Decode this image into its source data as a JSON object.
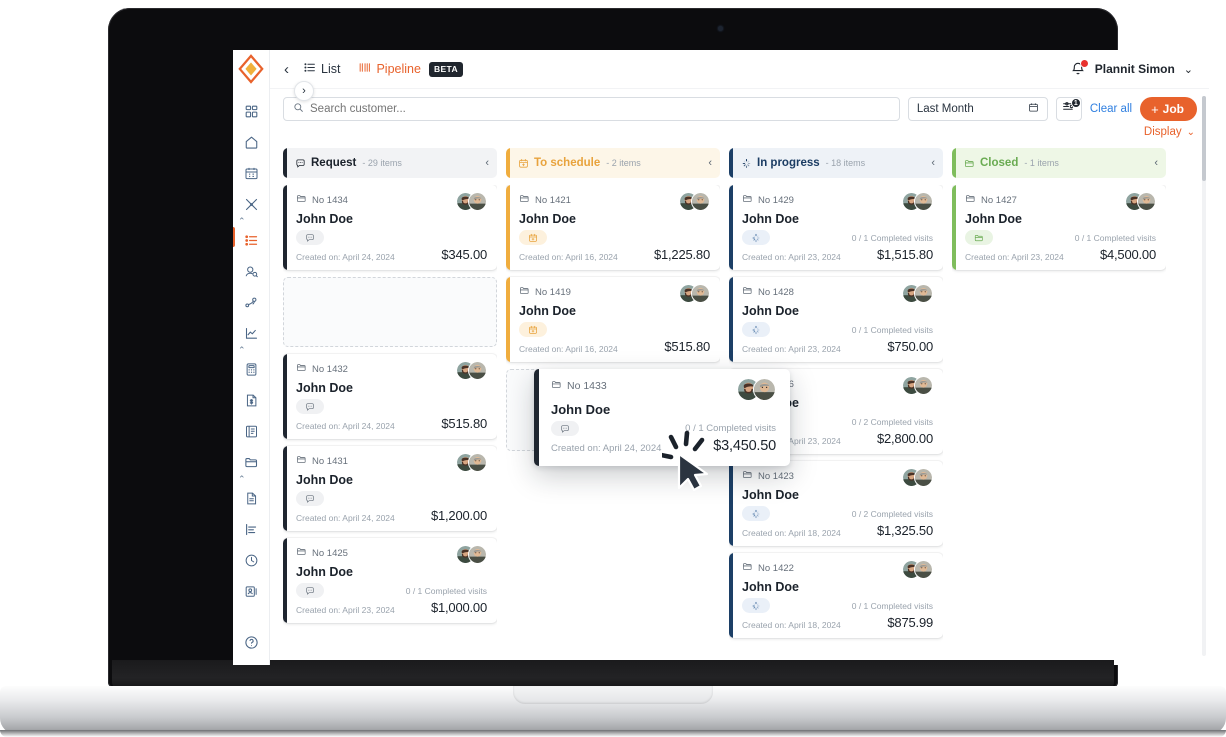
{
  "app": {
    "brand_accent": "#e8622c",
    "nav": {
      "back_icon": "chevron-left-icon",
      "tabs": [
        {
          "label": "List",
          "icon": "list-icon",
          "active": false
        },
        {
          "label": "Pipeline",
          "icon": "pipeline-icon",
          "active": true
        }
      ],
      "beta_badge": "BETA",
      "user_name": "Plannit Simon",
      "bell_icon": "notification-bell-icon",
      "user_caret_icon": "chevron-down-icon"
    },
    "sidebar": {
      "expand_icon": "chevron-right-icon",
      "items": [
        {
          "name": "dashboard",
          "icon": "grid-icon"
        },
        {
          "name": "home",
          "icon": "home-icon"
        },
        {
          "name": "calendar",
          "icon": "calendar-icon"
        },
        {
          "name": "tools",
          "icon": "tools-icon",
          "has_chevron": true
        },
        {
          "name": "jobs",
          "icon": "list-lines-icon",
          "active": true
        },
        {
          "name": "customers",
          "icon": "people-search-icon"
        },
        {
          "name": "routes",
          "icon": "route-pin-icon"
        },
        {
          "name": "reports",
          "icon": "chart-line-icon",
          "has_chevron": true
        },
        {
          "name": "accounting",
          "icon": "calculator-icon"
        },
        {
          "name": "invoices",
          "icon": "invoice-dollar-icon"
        },
        {
          "name": "books",
          "icon": "book-icon"
        },
        {
          "name": "files",
          "icon": "folder-icon",
          "has_chevron": true
        },
        {
          "name": "documents",
          "icon": "document-icon"
        },
        {
          "name": "activity",
          "icon": "bars-left-icon"
        },
        {
          "name": "timesheet",
          "icon": "clock-icon"
        },
        {
          "name": "contacts",
          "icon": "contact-card-icon"
        }
      ],
      "help": {
        "name": "help",
        "icon": "question-circle-icon"
      }
    },
    "filters": {
      "search_placeholder": "Search customer...",
      "search_value": "",
      "search_icon": "search-icon",
      "date_range": "Last Month",
      "date_icon": "calendar-icon",
      "filter_icon": "sliders-icon",
      "filter_badge": "1",
      "clear_all": "Clear all",
      "add_job": "Job",
      "add_job_plus": "+",
      "display": "Display",
      "display_caret_icon": "chevron-down-icon"
    }
  },
  "board": {
    "columns": [
      {
        "id": "request",
        "title": "Request",
        "count": "- 29 items",
        "icon": "chat-bubble-icon",
        "bar_color": "#1f2630",
        "head_bg": "#f2f3f5",
        "title_color": "#1b222b",
        "pill_class": "",
        "collapse_icon": "chevron-left-icon",
        "cards": [
          {
            "no": "No 1434",
            "name": "John Doe",
            "visits": "",
            "created": "Created on: April 24, 2024",
            "amount": "$345.00",
            "pill_icon": "chat-bubble-icon"
          },
          {
            "ghost": true,
            "height": 70
          },
          {
            "no": "No 1432",
            "name": "John Doe",
            "visits": "",
            "created": "Created on: April 24, 2024",
            "amount": "$515.80",
            "pill_icon": "chat-bubble-icon"
          },
          {
            "no": "No 1431",
            "name": "John Doe",
            "visits": "",
            "created": "Created on: April 24, 2024",
            "amount": "$1,200.00",
            "pill_icon": "chat-bubble-icon"
          },
          {
            "no": "No 1425",
            "name": "John Doe",
            "visits": "0 / 1 Completed visits",
            "created": "Created on: April 23, 2024",
            "amount": "$1,000.00",
            "pill_icon": "chat-bubble-icon"
          }
        ]
      },
      {
        "id": "to-schedule",
        "title": "To schedule",
        "count": "- 2 items",
        "icon": "calendar-plus-icon",
        "bar_color": "#f0ad3e",
        "head_bg": "#fdf6e8",
        "title_color": "#e8a33d",
        "pill_class": "amber",
        "collapse_icon": "chevron-left-icon",
        "cards": [
          {
            "no": "No 1421",
            "name": "John Doe",
            "visits": "",
            "created": "Created on: April 16, 2024",
            "amount": "$1,225.80",
            "pill_icon": "calendar-plus-icon"
          },
          {
            "no": "No 1419",
            "name": "John Doe",
            "visits": "",
            "created": "Created on: April 16, 2024",
            "amount": "$515.80",
            "pill_icon": "calendar-plus-icon"
          },
          {
            "ghost": true,
            "height": 82
          }
        ]
      },
      {
        "id": "in-progress",
        "title": "In progress",
        "count": "- 18 items",
        "icon": "spinner-icon",
        "bar_color": "#1c3f66",
        "head_bg": "#eef2f7",
        "title_color": "#1b3c63",
        "pill_class": "blue",
        "collapse_icon": "chevron-left-icon",
        "cards": [
          {
            "no": "No 1429",
            "name": "John Doe",
            "visits": "0 / 1 Completed visits",
            "created": "Created on: April 23, 2024",
            "amount": "$1,515.80",
            "pill_icon": "spinner-icon"
          },
          {
            "no": "No 1428",
            "name": "John Doe",
            "visits": "0 / 1 Completed visits",
            "created": "Created on: April 23, 2024",
            "amount": "$750.00",
            "pill_icon": "spinner-icon"
          },
          {
            "no": "No 1426",
            "name": "John Doe",
            "visits": "0 / 2 Completed visits",
            "created": "Created on: April 23, 2024",
            "amount": "$2,800.00",
            "pill_icon": "spinner-icon"
          },
          {
            "no": "No 1423",
            "name": "John Doe",
            "visits": "0 / 2 Completed visits",
            "created": "Created on: April 18, 2024",
            "amount": "$1,325.50",
            "pill_icon": "spinner-icon"
          },
          {
            "no": "No 1422",
            "name": "John Doe",
            "visits": "0 / 1 Completed visits",
            "created": "Created on: April 18, 2024",
            "amount": "$875.99",
            "pill_icon": "spinner-icon"
          }
        ]
      },
      {
        "id": "closed",
        "title": "Closed",
        "count": "- 1 items",
        "icon": "folder-icon",
        "bar_color": "#7fbd5c",
        "head_bg": "#eef7e6",
        "title_color": "#6aab52",
        "pill_class": "green",
        "collapse_icon": "chevron-left-icon",
        "cards": [
          {
            "no": "No 1427",
            "name": "John Doe",
            "visits": "0 / 1 Completed visits",
            "created": "Created on: April 23, 2024",
            "amount": "$4,500.00",
            "pill_icon": "folder-icon"
          }
        ]
      }
    ],
    "dragging_card": {
      "no": "No 1433",
      "name": "John Doe",
      "visits": "0 / 1 Completed visits",
      "created": "Created on: April 24, 2024",
      "amount": "$3,450.50",
      "pill_icon": "chat-bubble-icon",
      "bar_color": "#1f2630"
    }
  }
}
